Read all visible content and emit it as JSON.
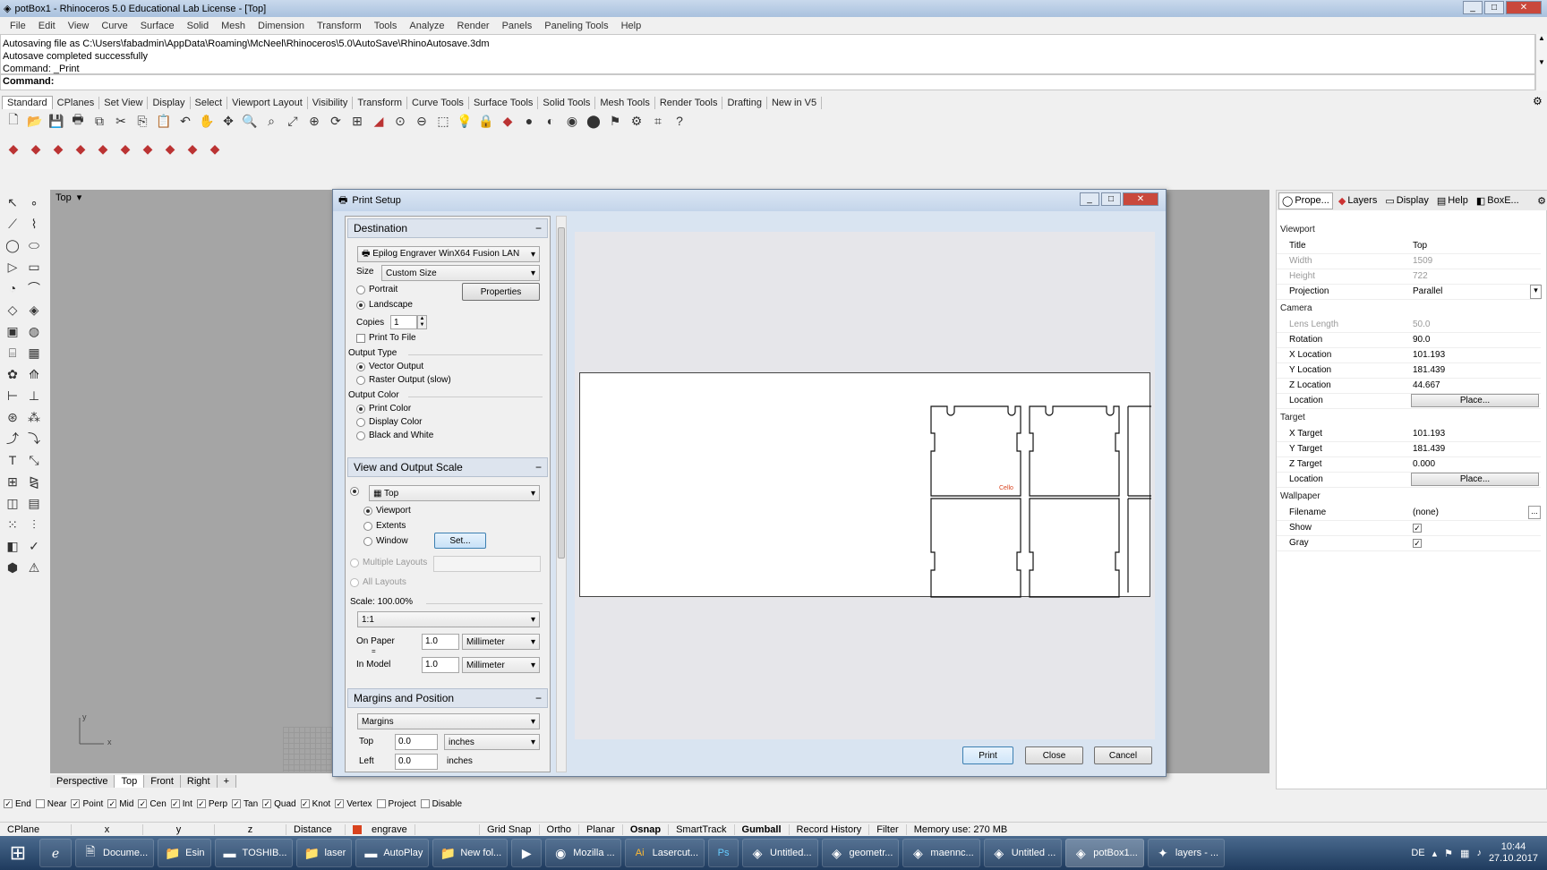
{
  "window": {
    "title": "potBox1 - Rhinoceros 5.0 Educational Lab License - [Top]",
    "minimize": "_",
    "maximize": "□",
    "close": "✕"
  },
  "menu": [
    "File",
    "Edit",
    "View",
    "Curve",
    "Surface",
    "Solid",
    "Mesh",
    "Dimension",
    "Transform",
    "Tools",
    "Analyze",
    "Render",
    "Panels",
    "Paneling Tools",
    "Help"
  ],
  "command_history": [
    "Autosaving file as C:\\Users\\fabadmin\\AppData\\Roaming\\McNeel\\Rhinoceros\\5.0\\AutoSave\\RhinoAutosave.3dm",
    "Autosave completed successfully",
    "Command: _Print"
  ],
  "command_prompt": "Command:",
  "toolbar_tabs": [
    "Standard",
    "CPlanes",
    "Set View",
    "Display",
    "Select",
    "Viewport Layout",
    "Visibility",
    "Transform",
    "Curve Tools",
    "Surface Tools",
    "Solid Tools",
    "Mesh Tools",
    "Render Tools",
    "Drafting",
    "New in V5"
  ],
  "viewport": {
    "label": "Top",
    "dropdown": "▾",
    "axis_x": "x",
    "axis_y": "y",
    "tabs": [
      "Perspective",
      "Top",
      "Front",
      "Right"
    ],
    "add_tab": "+"
  },
  "dialog": {
    "title": "Print Setup",
    "destination": {
      "header": "Destination",
      "collapse": "−",
      "printer": "Epilog Engraver WinX64 Fusion LAN",
      "size_label": "Size",
      "size_value": "Custom Size",
      "portrait": "Portrait",
      "landscape": "Landscape",
      "properties_button": "Properties",
      "copies_label": "Copies",
      "copies_value": "1",
      "print_to_file": "Print To File",
      "output_type_label": "Output Type",
      "vector_output": "Vector Output",
      "raster_output": "Raster Output (slow)",
      "output_color_label": "Output Color",
      "print_color": "Print Color",
      "display_color": "Display Color",
      "black_white": "Black and White"
    },
    "view_scale": {
      "header": "View and Output Scale",
      "collapse": "−",
      "view_value": "Top",
      "viewport": "Viewport",
      "extents": "Extents",
      "window": "Window",
      "set_button": "Set...",
      "multiple_layouts": "Multiple Layouts",
      "all_layouts": "All Layouts",
      "scale_label": "Scale:  100.00%",
      "scale_value": "1:1",
      "on_paper_label": "On Paper",
      "on_paper_value": "1.0",
      "on_paper_unit": "Millimeter",
      "equals": "=",
      "in_model_label": "In Model",
      "in_model_value": "1.0",
      "in_model_unit": "Millimeter"
    },
    "margins": {
      "header": "Margins and Position",
      "collapse": "−",
      "mode_value": "Margins",
      "top_label": "Top",
      "top_value": "0.0",
      "top_unit": "inches",
      "left_label": "Left",
      "left_value": "0.0",
      "left_unit": "inches"
    },
    "preview_text": "Cello",
    "buttons": {
      "print": "Print",
      "close": "Close",
      "cancel": "Cancel"
    }
  },
  "properties": {
    "tabs": [
      "Prope...",
      "Layers",
      "Display",
      "Help",
      "BoxE..."
    ],
    "sections": {
      "viewport": "Viewport",
      "camera": "Camera",
      "target": "Target",
      "wallpaper": "Wallpaper"
    },
    "rows": [
      {
        "k": "Title",
        "v": "Top"
      },
      {
        "k": "Width",
        "v": "1509"
      },
      {
        "k": "Height",
        "v": "722"
      },
      {
        "k": "Projection",
        "v": "Parallel"
      },
      {
        "k": "Lens Length",
        "v": "50.0"
      },
      {
        "k": "Rotation",
        "v": "90.0"
      },
      {
        "k": "X Location",
        "v": "101.193"
      },
      {
        "k": "Y Location",
        "v": "181.439"
      },
      {
        "k": "Z Location",
        "v": "44.667"
      },
      {
        "k": "Location",
        "v": "Place..."
      },
      {
        "k": "X Target",
        "v": "101.193"
      },
      {
        "k": "Y Target",
        "v": "181.439"
      },
      {
        "k": "Z Target",
        "v": "0.000"
      },
      {
        "k": "Location",
        "v": "Place..."
      },
      {
        "k": "Filename",
        "v": "(none)"
      },
      {
        "k": "Show",
        "v": "✓"
      },
      {
        "k": "Gray",
        "v": "✓"
      }
    ]
  },
  "osnap": [
    "End",
    "Near",
    "Point",
    "Mid",
    "Cen",
    "Int",
    "Perp",
    "Tan",
    "Quad",
    "Knot",
    "Vertex",
    "Project",
    "Disable"
  ],
  "status": {
    "cplane": "CPlane",
    "x": "x",
    "y": "y",
    "z": "z",
    "distance": "Distance",
    "layer": "engrave",
    "grid_snap": "Grid Snap",
    "ortho": "Ortho",
    "planar": "Planar",
    "osnap": "Osnap",
    "smarttrack": "SmartTrack",
    "gumball": "Gumball",
    "record_history": "Record History",
    "filter": "Filter",
    "memory": "Memory use: 270 MB"
  },
  "taskbar": {
    "items": [
      "Docume...",
      "Esin",
      "TOSHIB...",
      "laser",
      "AutoPlay",
      "New fol...",
      "",
      "Mozilla ...",
      "Lasercut...",
      "",
      "Untitled...",
      "geometr...",
      "maennc...",
      "Untitled ...",
      "potBox1...",
      "layers - ..."
    ],
    "lang": "DE",
    "time": "10:44",
    "date": "27.10.2017"
  },
  "colors": {
    "accent": "#1f3b5e",
    "layer_swatch": "#d9431e"
  }
}
